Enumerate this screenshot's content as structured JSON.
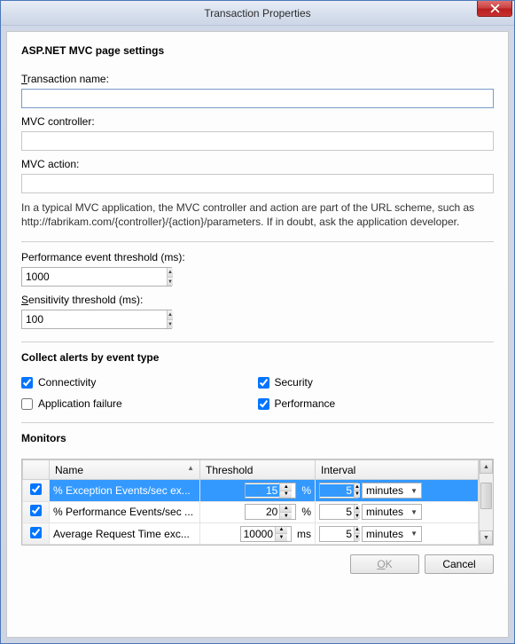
{
  "titlebar": {
    "title": "Transaction Properties",
    "faded_left": "",
    "faded_right": ""
  },
  "section1": {
    "heading": "ASP.NET MVC page settings",
    "transaction_label_pre": "T",
    "transaction_label_post": "ransaction name:",
    "transaction_value": "",
    "mvc_controller_label": "MVC controller:",
    "mvc_controller_value": "",
    "mvc_action_label": "MVC action:",
    "mvc_action_value": "",
    "hint": "In a typical MVC application, the MVC controller and action are part of the URL scheme, such as http://fabrikam.com/{controller}/{action}/parameters. If in doubt, ask the application developer."
  },
  "thresholds": {
    "perf_label": "Performance event threshold (ms):",
    "perf_value": "1000",
    "sens_label_pre": "S",
    "sens_label_post": "ensitivity threshold (ms):",
    "sens_value": "100"
  },
  "alerts": {
    "heading": "Collect alerts by event type",
    "connectivity": {
      "label": "Connectivity",
      "checked": true
    },
    "security": {
      "label": "Security",
      "checked": true
    },
    "app_failure": {
      "label": "Application failure",
      "checked": false
    },
    "performance": {
      "label": "Performance",
      "checked": true
    }
  },
  "monitors": {
    "heading": "Monitors",
    "columns": {
      "name": "Name",
      "threshold": "Threshold",
      "interval": "Interval"
    },
    "rows": [
      {
        "checked": true,
        "name": "% Exception Events/sec ex...",
        "threshold": "15",
        "unit": "%",
        "interval": "5",
        "interval_unit": "minutes",
        "selected": true
      },
      {
        "checked": true,
        "name": "% Performance Events/sec ...",
        "threshold": "20",
        "unit": "%",
        "interval": "5",
        "interval_unit": "minutes",
        "selected": false
      },
      {
        "checked": true,
        "name": "Average Request Time exc...",
        "threshold": "10000",
        "unit": "ms",
        "interval": "5",
        "interval_unit": "minutes",
        "selected": false
      }
    ]
  },
  "buttons": {
    "ok_pre": "O",
    "ok_post": "K",
    "cancel": "Cancel"
  }
}
